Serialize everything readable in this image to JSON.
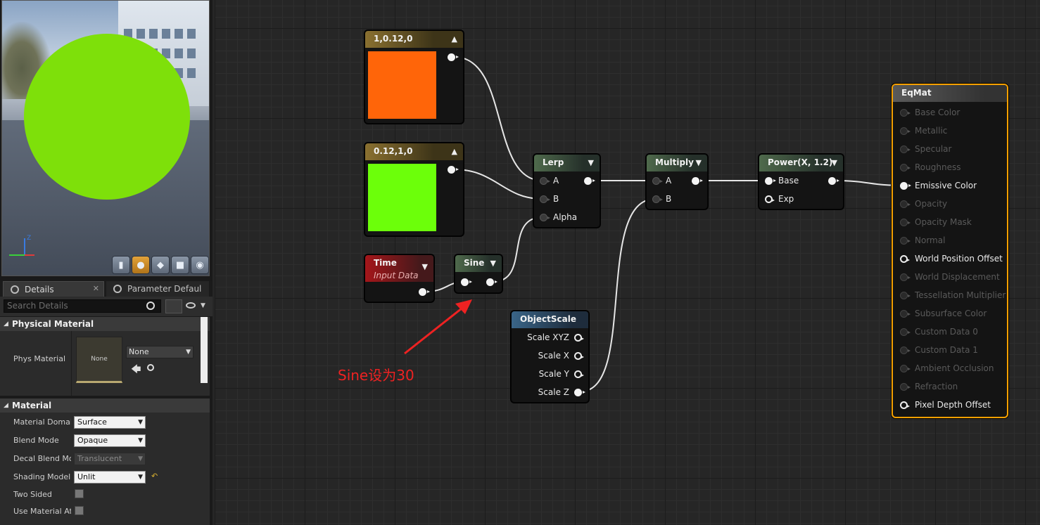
{
  "viewport": {
    "accent": "#7ee00a",
    "axis_z": "Z"
  },
  "tabs": {
    "details": "Details",
    "parameters": "Parameter Defaul"
  },
  "search": {
    "placeholder": "Search Details"
  },
  "physical_material": {
    "category": "Physical Material",
    "label": "Phys Material",
    "thumb": "None",
    "value": "None"
  },
  "material": {
    "category": "Material",
    "rows": [
      {
        "label": "Material Domair",
        "value": "Surface"
      },
      {
        "label": "Blend Mode",
        "value": "Opaque"
      },
      {
        "label": "Decal Blend Moc",
        "value": "Translucent"
      },
      {
        "label": "Shading Model",
        "value": "Unlit"
      },
      {
        "label": "Two Sided"
      },
      {
        "label": "Use Material Att"
      }
    ]
  },
  "nodes": {
    "const1": {
      "title": "1,0.12,0",
      "color": "#ff6509"
    },
    "const2": {
      "title": "0.12,1,0",
      "color": "#6cff0a"
    },
    "lerp": {
      "title": "Lerp",
      "pins": [
        "A",
        "B",
        "Alpha"
      ]
    },
    "multiply": {
      "title": "Multiply",
      "pins": [
        "A",
        "B"
      ]
    },
    "power": {
      "title": "Power(X, 1.2)",
      "pins": [
        "Base",
        "Exp"
      ]
    },
    "time": {
      "title": "Time",
      "subtitle": "Input Data"
    },
    "sine": {
      "title": "Sine"
    },
    "objectscale": {
      "title": "ObjectScale",
      "pins": [
        "Scale XYZ",
        "Scale X",
        "Scale Y",
        "Scale Z"
      ]
    },
    "eqmat": {
      "title": "EqMat",
      "pins": [
        "Base Color",
        "Metallic",
        "Specular",
        "Roughness",
        "Emissive Color",
        "Opacity",
        "Opacity Mask",
        "Normal",
        "World Position Offset",
        "World Displacement",
        "Tessellation Multiplier",
        "Subsurface Color",
        "Custom Data 0",
        "Custom Data 1",
        "Ambient Occlusion",
        "Refraction",
        "Pixel Depth Offset"
      ]
    }
  },
  "annotation": "Sine设为30"
}
